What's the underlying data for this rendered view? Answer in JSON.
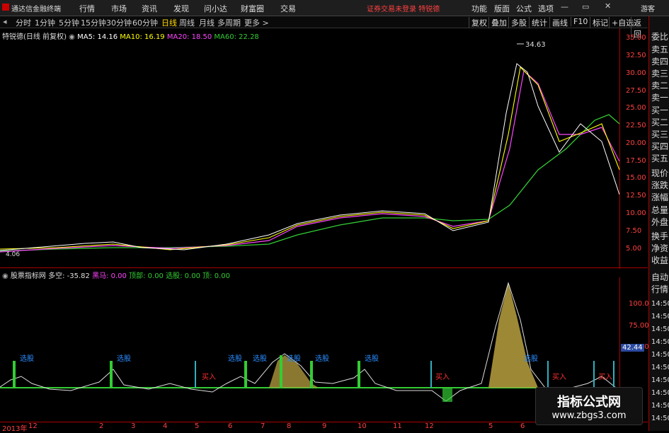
{
  "app": {
    "title": "通达信金融终端",
    "user": "游客"
  },
  "menu": [
    "行情",
    "市场",
    "资讯",
    "发现",
    "问小达",
    "财富圈",
    "交易"
  ],
  "notice": "证券交易未登录  特锐德",
  "top_right_menu": [
    "功能",
    "版面",
    "公式",
    "选项"
  ],
  "periods": [
    "分时",
    "1分钟",
    "5分钟",
    "15分钟",
    "30分钟",
    "60分钟",
    "日线",
    "周线",
    "月线",
    "多周期",
    "更多 >"
  ],
  "active_period": "日线",
  "toolbar_right": [
    "复权",
    "叠加",
    "多股",
    "统计",
    "画线",
    "F10",
    "标记",
    "+自选",
    "返回"
  ],
  "stock": {
    "name": "特锐德(日线 前复权)"
  },
  "ma": {
    "ma5": "MA5: 14.16",
    "ma10": "MA10: 16.19",
    "ma20": "MA20: 18.50",
    "ma60": "MA60: 22.28",
    "colors": {
      "ma5": "#ffffff",
      "ma10": "#ffff00",
      "ma20": "#ff44ff",
      "ma60": "#33cc33"
    }
  },
  "price_axis": [
    "35.00",
    "32.50",
    "30.00",
    "27.50",
    "25.00",
    "22.50",
    "20.00",
    "17.50",
    "15.00",
    "12.50",
    "10.00",
    "7.50",
    "5.00"
  ],
  "price_annotations": {
    "high": "34.63",
    "low": "4.06"
  },
  "side_panel": [
    "委比",
    "卖五",
    "卖四",
    "卖三",
    "卖二",
    "卖一",
    "买一",
    "买二",
    "买三",
    "买四",
    "买五",
    "现价",
    "涨跌",
    "涨幅",
    "总量",
    "外盘",
    "换手",
    "净资",
    "收益",
    "自动",
    "行情",
    "14:50",
    "14:50",
    "14:50",
    "14:50",
    "14:50",
    "14:50",
    "14:50",
    "14:50",
    "14:50",
    "14:50"
  ],
  "indicator": {
    "name": "股票指标网",
    "duokong": "多空: -35.82",
    "heima": "黑马: 0.00",
    "dingbu": "顶部: 0.00",
    "xuangu": "选股: 0.00",
    "ding": "顶: 0.00"
  },
  "indicator_axis": [
    "100.0",
    "75.00",
    "50.00"
  ],
  "indicator_value": "42.44",
  "signal_labels": [
    "选股",
    "选股",
    "选股",
    "选股",
    "选股",
    "选股",
    "选股",
    "选股"
  ],
  "buy_labels": [
    "买入",
    "买入",
    "买入",
    "买入",
    "买入"
  ],
  "date_axis": [
    "2013年",
    "12",
    "2",
    "3",
    "4",
    "5",
    "6",
    "7",
    "8",
    "9",
    "10",
    "11",
    "12",
    "5",
    "6"
  ],
  "watermark": {
    "line1": "指标公式网",
    "line2": "www.zbgs3.com"
  }
}
